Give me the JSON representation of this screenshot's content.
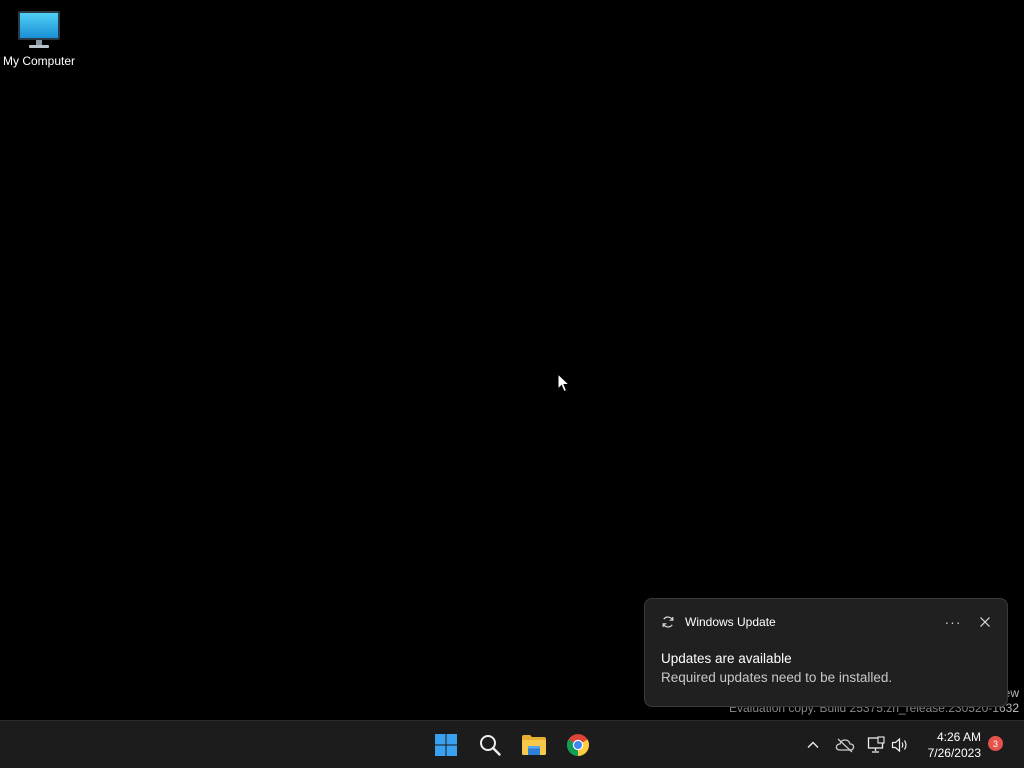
{
  "desktop": {
    "icons": [
      {
        "label": "My Computer",
        "icon": "monitor-icon"
      }
    ],
    "watermark": {
      "line1": "ew",
      "line2": "Evaluation copy. Build 25375.zn_release.230520-1632"
    }
  },
  "notification": {
    "app_name": "Windows Update",
    "app_icon": "sync-icon",
    "more_label": "···",
    "close_icon": "close-icon",
    "title": "Updates are available",
    "body": "Required updates need to be installed."
  },
  "taskbar": {
    "pinned": [
      {
        "name": "start",
        "icon": "windows-logo-icon"
      },
      {
        "name": "search",
        "icon": "search-icon"
      },
      {
        "name": "file-explorer",
        "icon": "folder-icon"
      },
      {
        "name": "chrome",
        "icon": "chrome-icon"
      }
    ],
    "tray": {
      "icons": [
        "chevron-up-icon",
        "onedrive-offline-icon",
        "network-icon",
        "volume-icon"
      ],
      "time": "4:26 AM",
      "date": "7/26/2023",
      "notification_count": "3"
    }
  },
  "colors": {
    "desktop_bg": "#000000",
    "taskbar_bg": "#1c1c1c",
    "toast_bg": "#202020",
    "badge": "#e5534b",
    "accent_blue": "#3aa0f0"
  }
}
